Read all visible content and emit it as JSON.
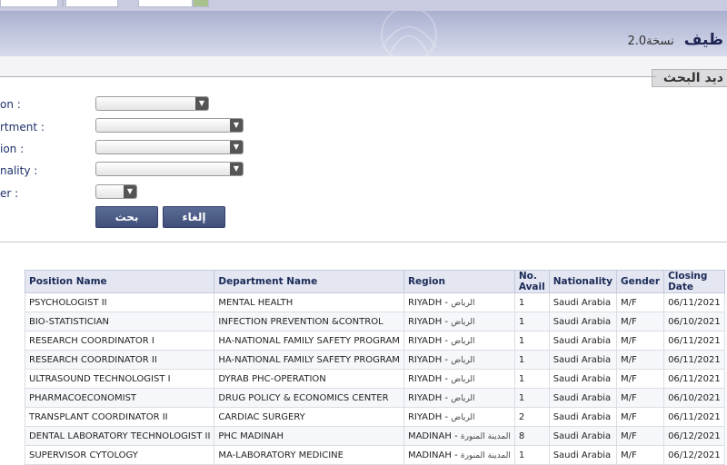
{
  "header": {
    "title": "ظيف",
    "version": "نسخة2.0"
  },
  "search": {
    "title": "ديد البحث",
    "labels": [
      "on :",
      "rtment :",
      "ion :",
      "nality :",
      "er :"
    ],
    "search_button": "بحث",
    "cancel_button": "إلغاء"
  },
  "table": {
    "headers": [
      "Position Name",
      "Department Name",
      "Region",
      "No. Avail",
      "Nationality",
      "Gender",
      "Closing Date"
    ],
    "rows": [
      {
        "position": "PSYCHOLOGIST II",
        "department": "MENTAL HEALTH",
        "region": "RIYADH -",
        "region_ar": "الرياض",
        "avail": "1",
        "nationality": "Saudi Arabia",
        "gender": "M/F",
        "closing": "06/11/2021"
      },
      {
        "position": "BIO-STATISTICIAN",
        "department": "INFECTION PREVENTION &CONTROL",
        "region": "RIYADH -",
        "region_ar": "الرياض",
        "avail": "1",
        "nationality": "Saudi Arabia",
        "gender": "M/F",
        "closing": "06/10/2021"
      },
      {
        "position": "RESEARCH COORDINATOR I",
        "department": "HA-NATIONAL FAMILY SAFETY PROGRAM",
        "region": "RIYADH -",
        "region_ar": "الرياض",
        "avail": "1",
        "nationality": "Saudi Arabia",
        "gender": "M/F",
        "closing": "06/11/2021"
      },
      {
        "position": "RESEARCH COORDINATOR II",
        "department": "HA-NATIONAL FAMILY SAFETY PROGRAM",
        "region": "RIYADH -",
        "region_ar": "الرياض",
        "avail": "1",
        "nationality": "Saudi Arabia",
        "gender": "M/F",
        "closing": "06/11/2021"
      },
      {
        "position": "ULTRASOUND TECHNOLOGIST I",
        "department": "DYRAB PHC-OPERATION",
        "region": "RIYADH -",
        "region_ar": "الرياض",
        "avail": "1",
        "nationality": "Saudi Arabia",
        "gender": "M/F",
        "closing": "06/11/2021"
      },
      {
        "position": "PHARMACOECONOMIST",
        "department": "DRUG POLICY & ECONOMICS CENTER",
        "region": "RIYADH -",
        "region_ar": "الرياض",
        "avail": "1",
        "nationality": "Saudi Arabia",
        "gender": "M/F",
        "closing": "06/10/2021"
      },
      {
        "position": "TRANSPLANT COORDINATOR II",
        "department": "CARDIAC SURGERY",
        "region": "RIYADH -",
        "region_ar": "الرياض",
        "avail": "2",
        "nationality": "Saudi Arabia",
        "gender": "M/F",
        "closing": "06/11/2021"
      },
      {
        "position": "DENTAL LABORATORY TECHNOLOGIST II",
        "department": "PHC MADINAH",
        "region": "MADINAH -",
        "region_ar": "المدينة المنورة",
        "avail": "8",
        "nationality": "Saudi Arabia",
        "gender": "M/F",
        "closing": "06/12/2021"
      },
      {
        "position": "SUPERVISOR CYTOLOGY",
        "department": "MA-LABORATORY MEDICINE",
        "region": "MADINAH -",
        "region_ar": "المدينة المنورة",
        "avail": "1",
        "nationality": "Saudi Arabia",
        "gender": "M/F",
        "closing": "06/12/2021"
      }
    ]
  }
}
